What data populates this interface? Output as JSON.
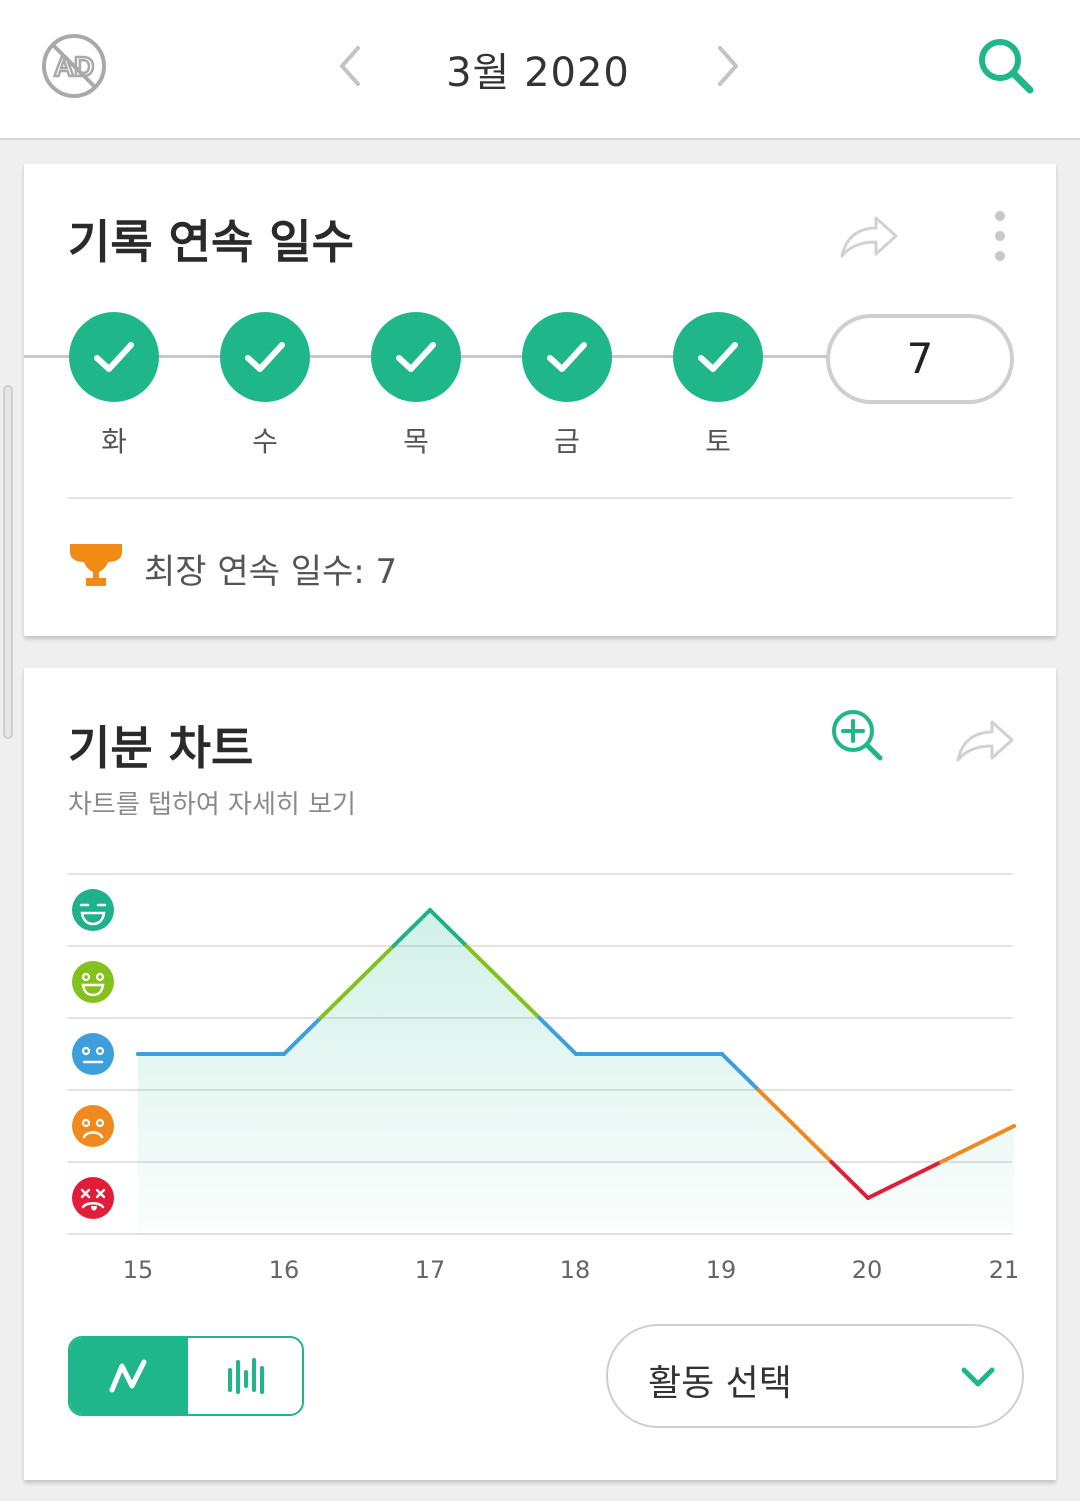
{
  "header": {
    "month_title": "3월 2020",
    "icons": [
      "no-ads-icon",
      "chevron-left-icon",
      "chevron-right-icon",
      "search-icon"
    ]
  },
  "streak_card": {
    "title": "기록 연속 일수",
    "days": [
      {
        "label": "화",
        "done": true
      },
      {
        "label": "수",
        "done": true
      },
      {
        "label": "목",
        "done": true
      },
      {
        "label": "금",
        "done": true
      },
      {
        "label": "토",
        "done": true
      }
    ],
    "current_streak": "7",
    "best_streak_text": "최장 연속 일수: 7",
    "icons": [
      "share-icon",
      "more-vert-icon",
      "trophy-icon"
    ]
  },
  "mood_card": {
    "title": "기분 차트",
    "subtitle": "차트를 탭하여 자세히 보기",
    "activity_select_label": "활동 선택",
    "view_modes": [
      "line-chart-icon",
      "bar-chart-icon"
    ],
    "selected_view": "line"
  },
  "chart_data": {
    "type": "line",
    "x": [
      "15",
      "16",
      "17",
      "18",
      "19",
      "20",
      "21"
    ],
    "y_levels": [
      "rad",
      "good",
      "meh",
      "bad",
      "awful"
    ],
    "level_colors": {
      "rad": "#1fb08c",
      "good": "#83c21d",
      "meh": "#3d9fdc",
      "bad": "#f08a20",
      "awful": "#e21d3a"
    },
    "values": [
      3,
      3,
      5,
      3,
      3,
      1,
      2
    ],
    "ylim": [
      1,
      5
    ],
    "grid": true,
    "area_fill": true
  },
  "colors": {
    "accent": "#1fb68a",
    "background": "#efefef",
    "card": "#ffffff"
  }
}
